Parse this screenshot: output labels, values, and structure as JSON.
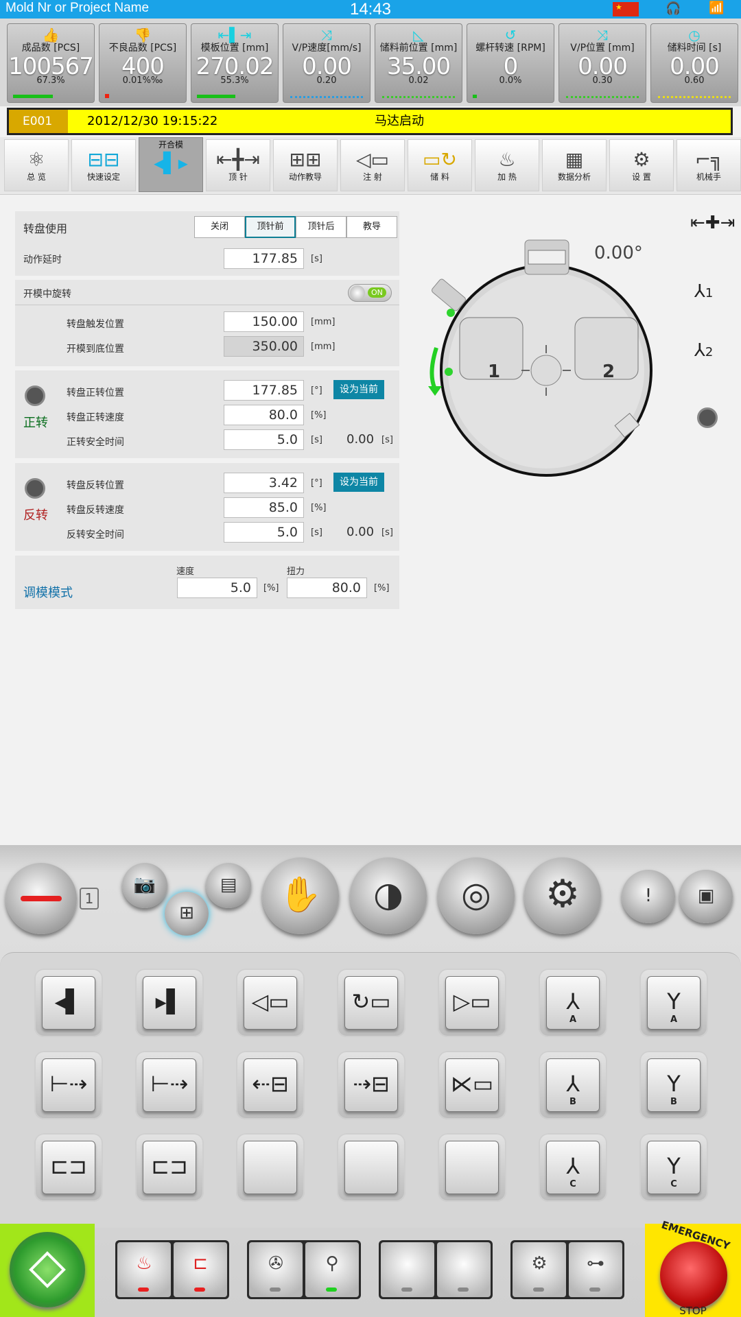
{
  "status": {
    "project": "Mold Nr or Project Name",
    "clock": "14:43",
    "flag_icon": "china-flag-icon",
    "headset_icon": "headset-icon",
    "wifi_icon": "wifi-icon"
  },
  "stats": [
    {
      "label": "成品数 [PCS]",
      "value": "100567",
      "pct": "67.3%",
      "icon": "thumb-up-icon"
    },
    {
      "label": "不良品数 [PCS]",
      "value": "400",
      "pct": "0.01%‰",
      "icon": "thumb-down-icon"
    },
    {
      "label": "模板位置 [mm]",
      "value": "270.02",
      "pct": "55.3%",
      "icon": "mold-position-icon"
    },
    {
      "label": "V/P速度[mm/s]",
      "value": "0.00",
      "pct": "0.20",
      "icon": "vp-speed-icon"
    },
    {
      "label": "储料前位置 [mm]",
      "value": "35.00",
      "pct": "0.02",
      "icon": "charge-position-icon"
    },
    {
      "label": "螺杆转速 [RPM]",
      "value": "0",
      "pct": "0.0%",
      "icon": "screw-speed-icon"
    },
    {
      "label": "V/P位置 [mm]",
      "value": "0.00",
      "pct": "0.30",
      "icon": "vp-position-icon"
    },
    {
      "label": "储料时间 [s]",
      "value": "0.00",
      "pct": "0.60",
      "icon": "clock-icon"
    }
  ],
  "alarm": {
    "code": "E001",
    "datetime": "2012/12/30 19:15:22",
    "message": "马达启动"
  },
  "menu": [
    {
      "label": "总 览",
      "icon": "atom-icon"
    },
    {
      "label": "快速设定",
      "icon": "quick-setup-icon"
    },
    {
      "label": "开合模",
      "icon": "mold-open-close-icon"
    },
    {
      "label": "顶 针",
      "icon": "ejector-icon"
    },
    {
      "label": "动作教导",
      "icon": "teach-icon"
    },
    {
      "label": "注 射",
      "icon": "injection-icon"
    },
    {
      "label": "储 料",
      "icon": "charge-icon"
    },
    {
      "label": "加 热",
      "icon": "heat-icon"
    },
    {
      "label": "数据分析",
      "icon": "chart-icon"
    },
    {
      "label": "设 置",
      "icon": "gear-icon"
    },
    {
      "label": "机械手",
      "icon": "robot-arm-icon"
    }
  ],
  "turntable": {
    "title": "转盘使用",
    "modes": [
      "关闭",
      "顶针前",
      "顶针后",
      "教导"
    ],
    "selected_mode": "顶针前",
    "delay_label": "动作延时",
    "delay_value": "177.85",
    "unit_s": "[s]",
    "unit_mm": "[mm]",
    "unit_deg": "[°]",
    "unit_pct": "[%]",
    "rotate_open_label": "开模中旋转",
    "toggle_state": "ON",
    "trigger_label": "转盘触发位置",
    "trigger_value": "150.00",
    "open_end_label": "开模到底位置",
    "open_end_value": "350.00",
    "fwd": {
      "title": "正转",
      "pos_label": "转盘正转位置",
      "pos_value": "177.85",
      "speed_label": "转盘正转速度",
      "speed_value": "80.0",
      "safe_label": "正转安全时间",
      "safe_value": "5.0",
      "safe_actual": "0.00",
      "set_button": "设为当前"
    },
    "rev": {
      "title": "反转",
      "pos_label": "转盘反转位置",
      "pos_value": "3.42",
      "speed_label": "转盘反转速度",
      "speed_value": "85.0",
      "safe_label": "反转安全时间",
      "safe_value": "5.0",
      "safe_actual": "0.00",
      "set_button": "设为当前"
    },
    "adjust": {
      "title": "调模模式",
      "speed_label": "速度",
      "speed_value": "5.0",
      "torque_label": "扭力",
      "torque_value": "80.0"
    },
    "angle": "0.00°",
    "station1": "1",
    "station2": "2",
    "side_labels": [
      "1",
      "2"
    ]
  },
  "controls": {
    "selector_number": "1",
    "keys_row1_subs": [
      "",
      "",
      "",
      "",
      "",
      "A",
      "A"
    ],
    "keys_row2_subs": [
      "",
      "",
      "",
      "",
      "",
      "B",
      "B"
    ],
    "keys_row3_subs": [
      "",
      "",
      "",
      "",
      "",
      "C",
      "C"
    ],
    "emergency_top": "EMERGENCY",
    "emergency_bottom": "STOP"
  }
}
